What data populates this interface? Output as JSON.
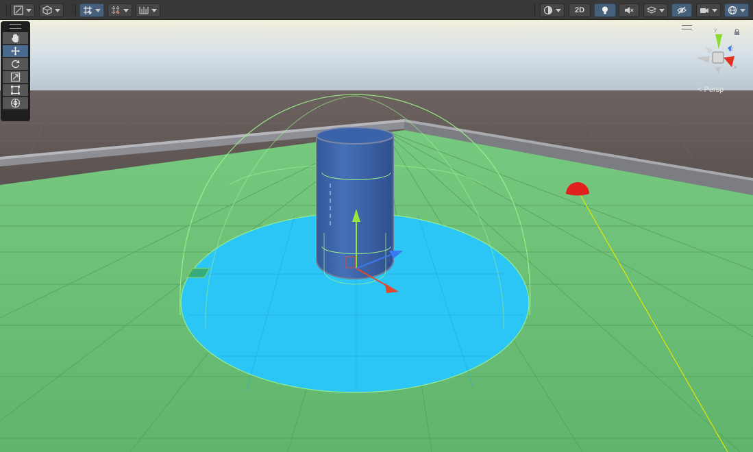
{
  "toolbar": {
    "left_groups": [
      {
        "icon": "draw-mode-icon"
      },
      {
        "icon": "render-cube-icon"
      },
      {
        "icon": "grid-snap-icon"
      },
      {
        "icon": "increment-snap-icon"
      },
      {
        "icon": "ruler-grid-icon"
      }
    ],
    "btn_2d_label": "2D",
    "right_icons": [
      "shading-mode-icon",
      "lighting-icon",
      "audio-mute-icon",
      "effects-icon",
      "scene-visibility-icon",
      "camera-icon",
      "gizmos-icon"
    ]
  },
  "tools": [
    "view-tool",
    "move-tool",
    "rotate-tool",
    "scale-tool",
    "rect-tool",
    "transform-tool"
  ],
  "active_tool": "move-tool",
  "gizmo": {
    "axis_y": "y",
    "axis_z": "z",
    "axis_x": "x",
    "persp_label": "Persp"
  },
  "colors": {
    "ground": "#6dbd74",
    "sky": "#c6d6e4",
    "horizon": "#5e5553",
    "wall": "#8d8e94",
    "disc": "#2bc5f6",
    "cylinder": "#3c62a6",
    "selection_wire": "#9ef58a",
    "handle_y": "#9be33f",
    "handle_x": "#e04a2c",
    "handle_z": "#3a7af0",
    "light_bulb": "#e0211e",
    "light_ray": "#e6e600"
  }
}
